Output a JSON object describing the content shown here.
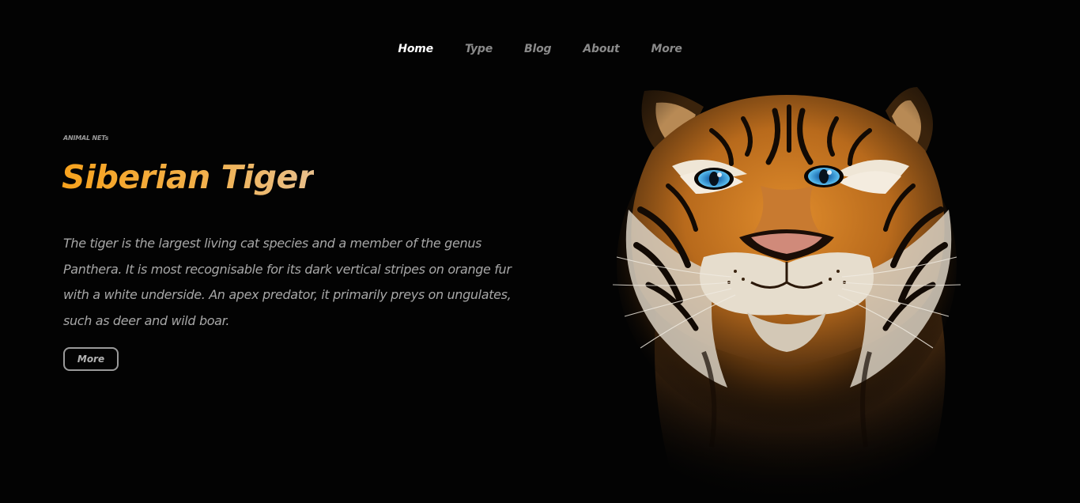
{
  "nav": {
    "items": [
      {
        "label": "Home",
        "active": true
      },
      {
        "label": "Type",
        "active": false
      },
      {
        "label": "Blog",
        "active": false
      },
      {
        "label": "About",
        "active": false
      },
      {
        "label": "More",
        "active": false
      }
    ]
  },
  "hero": {
    "eyebrow": "ANIMAL NETs",
    "title": "Siberian Tiger",
    "description": "The tiger is the largest living cat species and a member of the genus Panthera. It is most recognisable for its dark vertical stripes on orange fur with a white underside. An apex predator, it primarily preys on ungulates, such as deer and wild boar.",
    "button_label": "More"
  },
  "image": {
    "icon": "tiger-portrait-image"
  },
  "colors": {
    "background": "#030303",
    "title_gradient_start": "#f7a21d",
    "title_gradient_end": "#e9c08c",
    "nav_active": "#ffffff",
    "nav_inactive": "#8a8a8a",
    "text": "#a7a7a7",
    "tiger_eye": "#3aa8e8"
  }
}
